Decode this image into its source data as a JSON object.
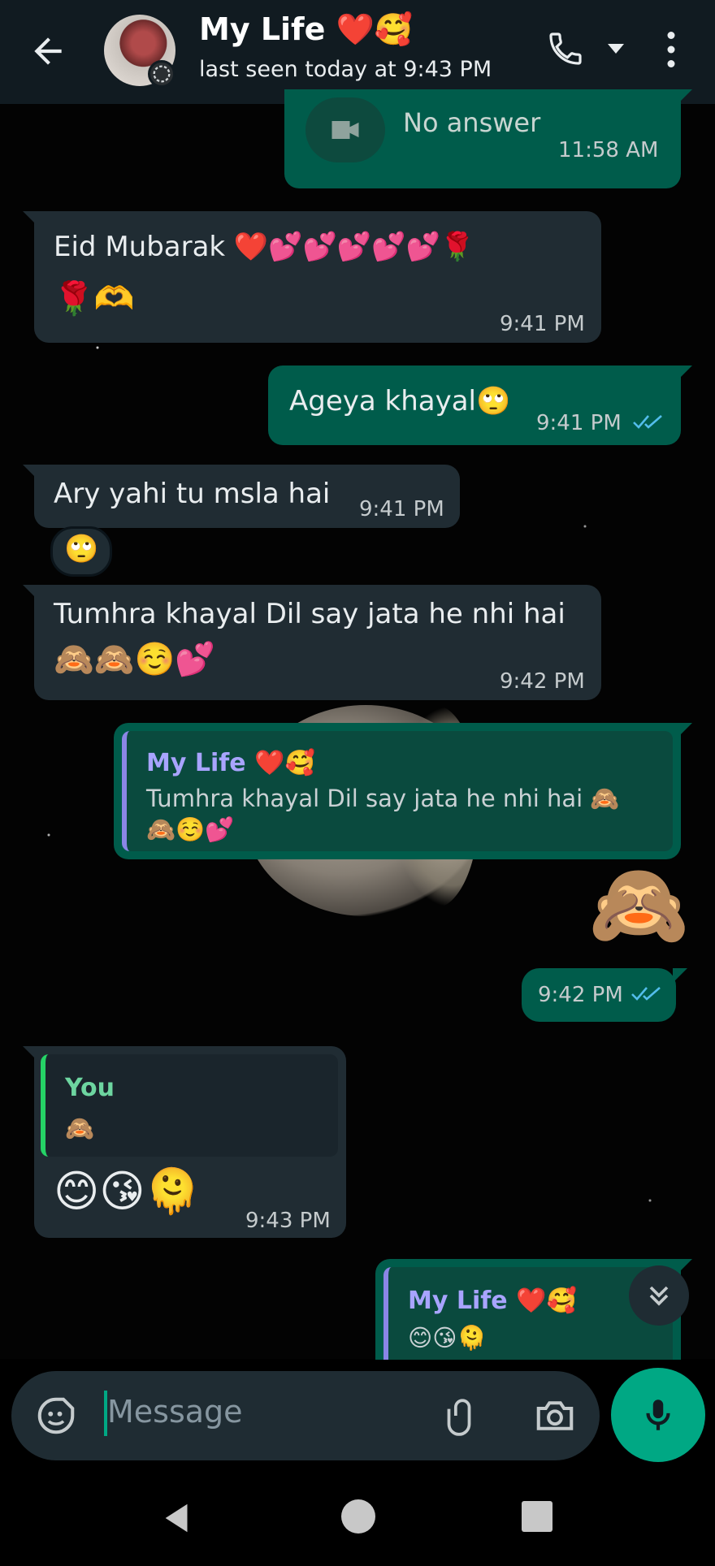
{
  "header": {
    "name": "My Life ❤️🥰",
    "status": "last seen today at 9:43 PM"
  },
  "messages": {
    "call": {
      "title": "Video call",
      "text": "No answer",
      "time": "11:58 AM"
    },
    "m1": {
      "text": "Eid Mubarak ❤️💕💕💕💕💕🌹",
      "line2": "🌹🫶",
      "time": "9:41 PM"
    },
    "m2": {
      "text": "Ageya khayal🙄",
      "time": "9:41 PM"
    },
    "m3": {
      "text": "Ary yahi tu msla hai",
      "time": "9:41 PM",
      "reaction": "🙄"
    },
    "m4": {
      "text": "Tumhra khayal Dil say jata he nhi hai",
      "line2": "🙈🙈☺️💕",
      "time": "9:42 PM"
    },
    "m5": {
      "quote_name": "My Life ❤️🥰",
      "quote_text": "Tumhra khayal Dil say jata he nhi hai 🙈",
      "quote_text2": "🙈☺️💕"
    },
    "m6": {
      "emoji": "🙈",
      "time": "9:42 PM"
    },
    "m7": {
      "quote_name": "You",
      "quote_text": "🙈",
      "emoji": "😊😘🫠",
      "time": "9:43 PM"
    },
    "m8": {
      "quote_name": "My Life ❤️🥰",
      "quote_text": "😊😘🫠"
    }
  },
  "input": {
    "placeholder": "Message"
  },
  "colors": {
    "incoming": "#202c33",
    "outgoing": "#005c4b",
    "accent": "#00a884",
    "ticks": "#53bdeb"
  },
  "icons": {
    "back": "back-arrow-icon",
    "call": "phone-icon",
    "drop": "dropdown-icon",
    "menu": "more-vert-icon",
    "sticker": "sticker-icon",
    "attach": "paperclip-icon",
    "camera": "camera-icon",
    "mic": "mic-icon",
    "scroll": "double-chevron-down-icon"
  }
}
